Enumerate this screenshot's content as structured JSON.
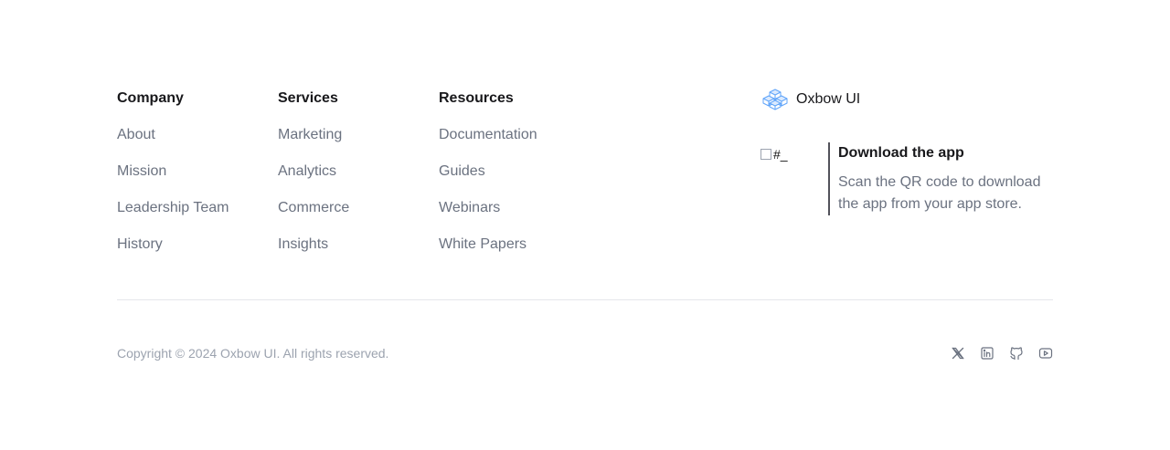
{
  "columns": {
    "company": {
      "heading": "Company",
      "links": [
        "About",
        "Mission",
        "Leadership Team",
        "History"
      ]
    },
    "services": {
      "heading": "Services",
      "links": [
        "Marketing",
        "Analytics",
        "Commerce",
        "Insights"
      ]
    },
    "resources": {
      "heading": "Resources",
      "links": [
        "Documentation",
        "Guides",
        "Webinars",
        "White Papers"
      ]
    }
  },
  "brand": {
    "name": "Oxbow UI",
    "logo_icon": "stacked-cubes-icon",
    "logo_color": "#60a5fa"
  },
  "app": {
    "qr_alt_text": "#_",
    "title": "Download the app",
    "description": "Scan the QR code to download the app from your app store."
  },
  "footer": {
    "copyright": "Copyright © 2024 Oxbow UI. All rights reserved.",
    "social": [
      {
        "icon": "x-twitter-icon"
      },
      {
        "icon": "linkedin-icon"
      },
      {
        "icon": "github-icon"
      },
      {
        "icon": "youtube-icon"
      }
    ]
  }
}
